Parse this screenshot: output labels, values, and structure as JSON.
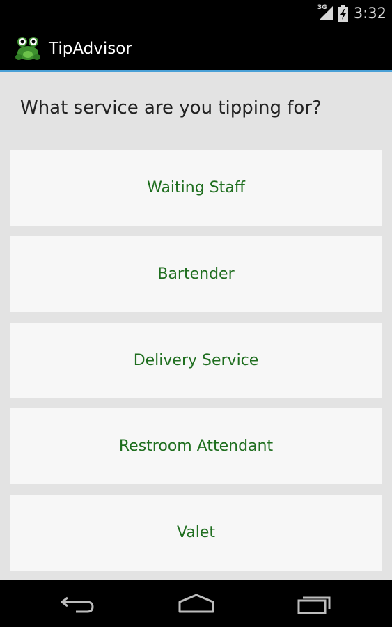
{
  "status_bar": {
    "network": "3G",
    "time": "3:32"
  },
  "action_bar": {
    "title": "TipAdvisor",
    "logo_icon": "frog-logo-icon"
  },
  "main": {
    "question": "What service are you tipping for?",
    "options": [
      {
        "label": "Waiting Staff"
      },
      {
        "label": "Bartender"
      },
      {
        "label": "Delivery Service"
      },
      {
        "label": "Restroom Attendant"
      },
      {
        "label": "Valet"
      }
    ]
  },
  "nav_bar": {
    "back_icon": "back-icon",
    "home_icon": "home-icon",
    "recents_icon": "recent-apps-icon"
  },
  "colors": {
    "accent": "#4aa0d6",
    "option_text": "#1f6e1f",
    "background": "#e3e3e3",
    "card": "#f7f7f7"
  }
}
